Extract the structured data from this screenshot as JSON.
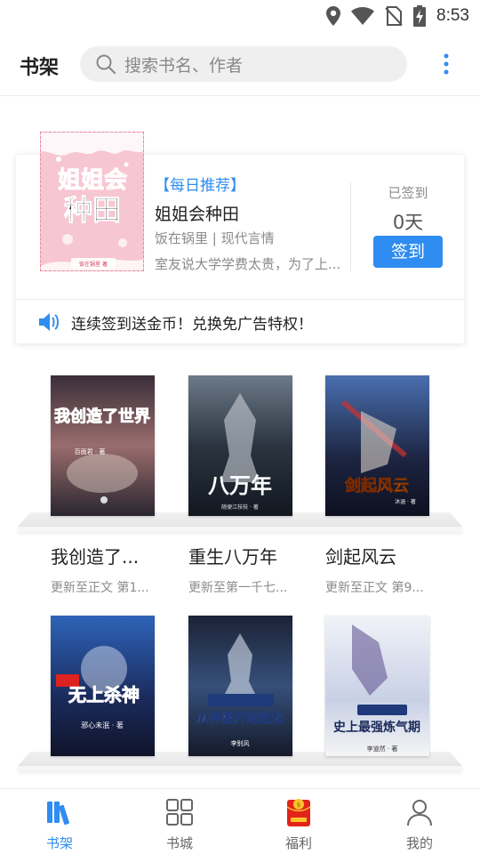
{
  "status_bar": {
    "time": "8:53"
  },
  "header": {
    "title": "书架",
    "search_placeholder": "搜索书名、作者"
  },
  "daily": {
    "tag": "【每日推荐】",
    "book_title": "姐姐会种田",
    "meta": "饭在锅里 | 现代言情",
    "desc": "室友说大学学费太贵，为了上...",
    "cover_title_1": "姐姐会",
    "cover_title_2": "种田",
    "cover_author": "饭在锅里 著",
    "signed_label": "已签到",
    "signed_days": "0天",
    "sign_button": "签到",
    "notice": "连续签到送金币！兑换免广告特权！"
  },
  "books": [
    {
      "name": "我创造了...",
      "update": "更新至正文 第1...",
      "cover_title": "我创造了世界",
      "cover_author": "百面君 · 著"
    },
    {
      "name": "重生八万年",
      "update": "更新至第一千七...",
      "cover_title": "八万年",
      "cover_author": "随便江枝枝 · 著"
    },
    {
      "name": "剑起风云",
      "update": "更新至正文 第9...",
      "cover_title": "剑起风云",
      "cover_author": "沐涵 · 著"
    },
    {
      "name": "无上杀神",
      "update": "",
      "cover_title": "无上杀神",
      "cover_author": "邪心未泯 · 著"
    },
    {
      "name": "从神格开始进化",
      "update": "",
      "cover_title": "从神格开始进化",
      "cover_author": "李别风"
    },
    {
      "name": "史上最强炼气期",
      "update": "",
      "cover_title": "史上最强炼气期",
      "cover_author": "李道然 · 著"
    }
  ],
  "nav": [
    {
      "label": "书架",
      "icon": "bookshelf-icon",
      "active": true
    },
    {
      "label": "书城",
      "icon": "grid-icon",
      "active": false
    },
    {
      "label": "福利",
      "icon": "red-envelope-icon",
      "active": false
    },
    {
      "label": "我的",
      "icon": "user-icon",
      "active": false
    }
  ],
  "colors": {
    "accent": "#2f8cf0",
    "text": "#222222",
    "muted": "#8b8b8b"
  }
}
